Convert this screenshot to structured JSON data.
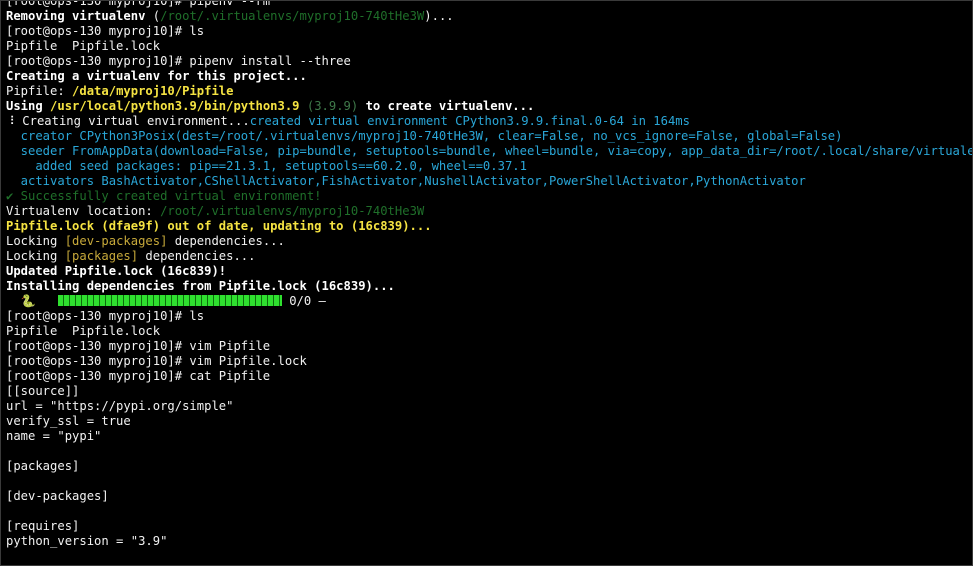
{
  "colors": {
    "background": "#000000",
    "default_text": "#f2f2f2",
    "bold_white": "#ffffff",
    "yellow": "#f5e342",
    "cyan": "#2aa7d8",
    "dim_green": "#1f6f2a",
    "dim_gray": "#3f7a4a",
    "olive": "#c7a93a",
    "progress_green": "#2fe02f"
  },
  "terminal": {
    "lines": [
      [
        {
          "t": "[root@ops-130 myproj10]# pipenv --rm",
          "c": "default_text"
        }
      ],
      [
        {
          "t": "Removing virtualenv",
          "c": "bold_white",
          "b": true
        },
        {
          "t": " (",
          "c": "default_text"
        },
        {
          "t": "/root/.virtualenvs/myproj10-740tHe3W",
          "c": "dim_green"
        },
        {
          "t": ")...",
          "c": "default_text"
        }
      ],
      [
        {
          "t": "[root@ops-130 myproj10]# ls",
          "c": "default_text"
        }
      ],
      [
        {
          "t": "Pipfile  Pipfile.lock",
          "c": "default_text"
        }
      ],
      [
        {
          "t": "[root@ops-130 myproj10]# pipenv install --three",
          "c": "default_text"
        }
      ],
      [
        {
          "t": "Creating a virtualenv for this project...",
          "c": "bold_white",
          "b": true
        }
      ],
      [
        {
          "t": "Pipfile: ",
          "c": "default_text"
        },
        {
          "t": "/data/myproj10/Pipfile",
          "c": "yellow",
          "b": true
        }
      ],
      [
        {
          "t": "Using ",
          "c": "bold_white",
          "b": true
        },
        {
          "t": "/usr/local/python3.9/bin/python3.9",
          "c": "yellow",
          "b": true
        },
        {
          "t": " (3.9.9) ",
          "c": "dim_gray"
        },
        {
          "t": "to create virtualenv...",
          "c": "bold_white",
          "b": true
        }
      ],
      [
        {
          "t": "⠸ Creating virtual environment...",
          "c": "default_text"
        },
        {
          "t": "created virtual environment CPython3.9.9.final.0-64 in 164ms",
          "c": "cyan"
        }
      ],
      [
        {
          "t": "  creator CPython3Posix(dest=/root/.virtualenvs/myproj10-740tHe3W, clear=False, no_vcs_ignore=False, global=False)",
          "c": "cyan"
        }
      ],
      [
        {
          "t": "  seeder FromAppData(download=False, pip=bundle, setuptools=bundle, wheel=bundle, via=copy, app_data_dir=/root/.local/share/virtualenv)",
          "c": "cyan"
        }
      ],
      [
        {
          "t": "    added seed packages: pip==21.3.1, setuptools==60.2.0, wheel==0.37.1",
          "c": "cyan"
        }
      ],
      [
        {
          "t": "  activators BashActivator,CShellActivator,FishActivator,NushellActivator,PowerShellActivator,PythonActivator",
          "c": "cyan"
        }
      ],
      [
        {
          "t": "✔ Successfully created virtual environment!",
          "c": "dim_green"
        }
      ],
      [
        {
          "t": "Virtualenv location: ",
          "c": "default_text"
        },
        {
          "t": "/root/.virtualenvs/myproj10-740tHe3W",
          "c": "dim_green"
        }
      ],
      [
        {
          "t": "Pipfile.lock (dfae9f) out of date, updating to (16c839)...",
          "c": "yellow",
          "b": true
        }
      ],
      [
        {
          "t": "Locking ",
          "c": "default_text"
        },
        {
          "t": "[dev-packages]",
          "c": "olive"
        },
        {
          "t": " dependencies...",
          "c": "default_text"
        }
      ],
      [
        {
          "t": "Locking ",
          "c": "default_text"
        },
        {
          "t": "[packages]",
          "c": "olive"
        },
        {
          "t": " dependencies...",
          "c": "default_text"
        }
      ],
      [
        {
          "t": "Updated Pipfile.lock (16c839)!",
          "c": "bold_white",
          "b": true
        }
      ],
      [
        {
          "t": "Installing dependencies from Pipfile.lock (16c839)...",
          "c": "bold_white",
          "b": true
        }
      ],
      [
        {
          "t": "  🐍   ",
          "c": "default_text"
        },
        {
          "progress": 1.0
        },
        {
          "t": " 0/0 —",
          "c": "default_text"
        }
      ],
      [
        {
          "t": "[root@ops-130 myproj10]# ls",
          "c": "default_text"
        }
      ],
      [
        {
          "t": "Pipfile  Pipfile.lock",
          "c": "default_text"
        }
      ],
      [
        {
          "t": "[root@ops-130 myproj10]# vim Pipfile",
          "c": "default_text"
        }
      ],
      [
        {
          "t": "[root@ops-130 myproj10]# vim Pipfile.lock",
          "c": "default_text"
        }
      ],
      [
        {
          "t": "[root@ops-130 myproj10]# cat Pipfile",
          "c": "default_text"
        }
      ],
      [
        {
          "t": "[[source]]",
          "c": "default_text"
        }
      ],
      [
        {
          "t": "url = \"https://pypi.org/simple\"",
          "c": "default_text"
        }
      ],
      [
        {
          "t": "verify_ssl = true",
          "c": "default_text"
        }
      ],
      [
        {
          "t": "name = \"pypi\"",
          "c": "default_text"
        }
      ],
      [
        {
          "t": "",
          "c": "default_text"
        }
      ],
      [
        {
          "t": "[packages]",
          "c": "default_text"
        }
      ],
      [
        {
          "t": "",
          "c": "default_text"
        }
      ],
      [
        {
          "t": "[dev-packages]",
          "c": "default_text"
        }
      ],
      [
        {
          "t": "",
          "c": "default_text"
        }
      ],
      [
        {
          "t": "[requires]",
          "c": "default_text"
        }
      ],
      [
        {
          "t": "python_version = \"3.9\"",
          "c": "default_text"
        }
      ]
    ]
  }
}
